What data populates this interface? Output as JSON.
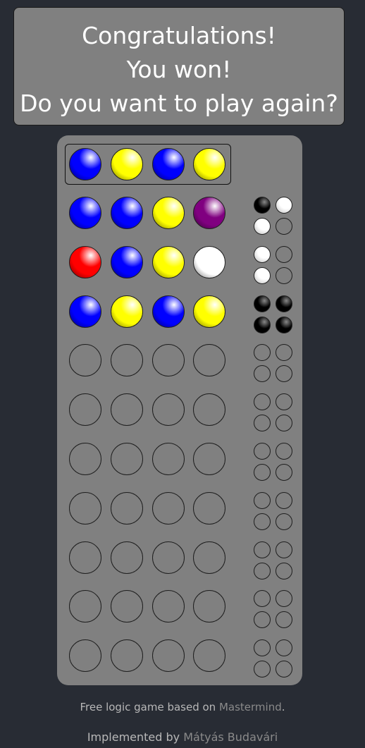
{
  "banner": {
    "line1": "Congratulations!",
    "line2": "You won!",
    "line3": "Do you want to play again?"
  },
  "colors": {
    "blue": "#0000ff",
    "yellow": "#ffff00",
    "red": "#ff0000",
    "purple": "#800080",
    "white": "#ffffff",
    "black": "#000000"
  },
  "secret": [
    "blue",
    "yellow",
    "blue",
    "yellow"
  ],
  "rows": [
    {
      "pegs": [
        "blue",
        "blue",
        "yellow",
        "purple"
      ],
      "feedback": [
        "black",
        "white",
        "white",
        "empty"
      ]
    },
    {
      "pegs": [
        "red",
        "blue",
        "yellow",
        "white"
      ],
      "feedback": [
        "white",
        "empty",
        "white",
        "empty"
      ]
    },
    {
      "pegs": [
        "blue",
        "yellow",
        "blue",
        "yellow"
      ],
      "feedback": [
        "black",
        "black",
        "black",
        "black"
      ]
    },
    {
      "pegs": [
        "empty",
        "empty",
        "empty",
        "empty"
      ],
      "feedback": [
        "empty",
        "empty",
        "empty",
        "empty"
      ]
    },
    {
      "pegs": [
        "empty",
        "empty",
        "empty",
        "empty"
      ],
      "feedback": [
        "empty",
        "empty",
        "empty",
        "empty"
      ]
    },
    {
      "pegs": [
        "empty",
        "empty",
        "empty",
        "empty"
      ],
      "feedback": [
        "empty",
        "empty",
        "empty",
        "empty"
      ]
    },
    {
      "pegs": [
        "empty",
        "empty",
        "empty",
        "empty"
      ],
      "feedback": [
        "empty",
        "empty",
        "empty",
        "empty"
      ]
    },
    {
      "pegs": [
        "empty",
        "empty",
        "empty",
        "empty"
      ],
      "feedback": [
        "empty",
        "empty",
        "empty",
        "empty"
      ]
    },
    {
      "pegs": [
        "empty",
        "empty",
        "empty",
        "empty"
      ],
      "feedback": [
        "empty",
        "empty",
        "empty",
        "empty"
      ]
    },
    {
      "pegs": [
        "empty",
        "empty",
        "empty",
        "empty"
      ],
      "feedback": [
        "empty",
        "empty",
        "empty",
        "empty"
      ]
    }
  ],
  "footer": {
    "line1_prefix": "Free logic game based on ",
    "line1_link": "Mastermind",
    "line1_suffix": ".",
    "line2_prefix": "Implemented by ",
    "line2_link": "Mátyás Budavári"
  }
}
